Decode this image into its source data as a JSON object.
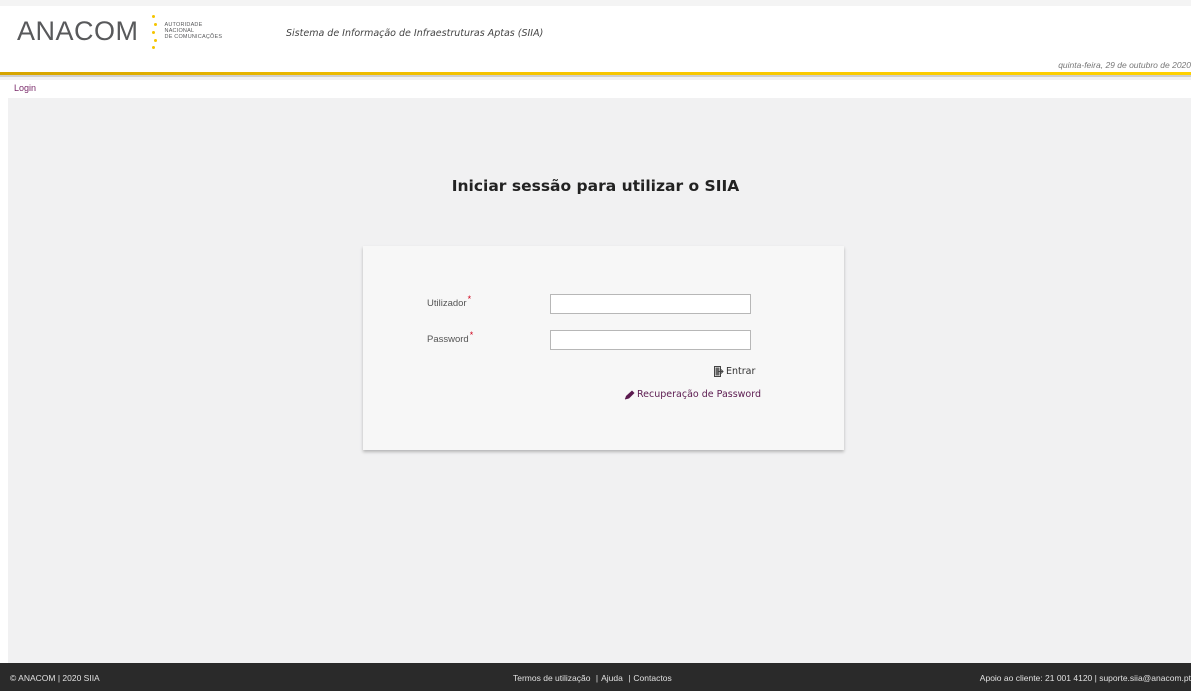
{
  "header": {
    "logo_text": "ANACOM",
    "logo_sub": [
      "AUTORIDADE",
      "NACIONAL",
      "DE COMUNICAÇÕES"
    ],
    "system_title": "Sistema de Informação de Infraestruturas Aptas (SIIA)",
    "date": "quinta-feira, 29 de outubro de 2020"
  },
  "breadcrumb": {
    "current": "Login"
  },
  "login": {
    "title": "Iniciar sessão para utilizar o SIIA",
    "user_label": "Utilizador",
    "password_label": "Password",
    "required_mark": "*",
    "user_value": "",
    "password_value": "",
    "submit_label": "Entrar",
    "recover_label": "Recuperação de Password"
  },
  "footer": {
    "copyright": "© ANACOM | 2020 SIIA",
    "links": [
      "Termos de utilização",
      "Ajuda",
      "Contactos"
    ],
    "support": "Apoio ao cliente:  21 001 4120 | suporte.siia@anacom.pt"
  },
  "colors": {
    "accent_yellow": "#f5c300",
    "link_purple": "#5b1a4f",
    "required_red": "#d0021b",
    "footer_bg": "#2a2a2a"
  },
  "icons": {
    "submit": "login-door-icon",
    "recover": "pencil-icon"
  }
}
